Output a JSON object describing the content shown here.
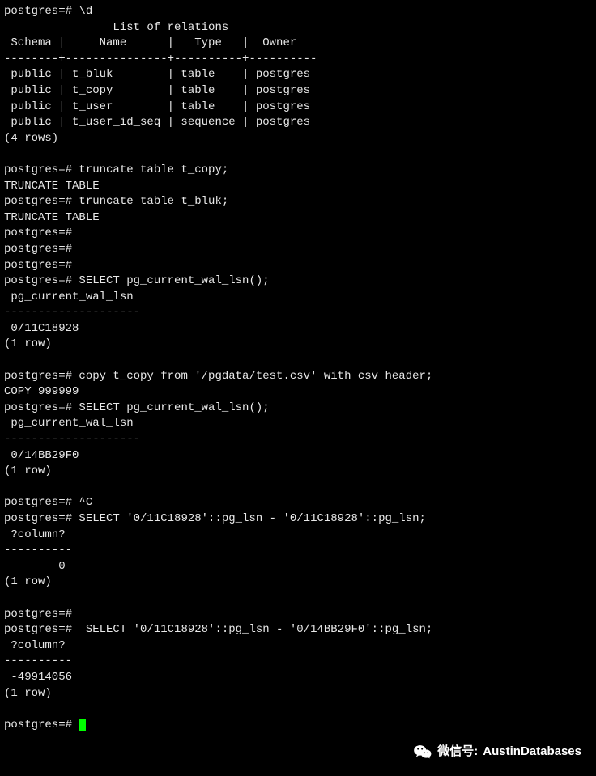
{
  "prompt": "postgres=#",
  "relations_header": "                List of relations",
  "relations_cols": " Schema |     Name      |   Type   |  Owner   ",
  "relations_sep": "--------+---------------+----------+----------",
  "relations_rows": [
    " public | t_bluk        | table    | postgres",
    " public | t_copy        | table    | postgres",
    " public | t_user        | table    | postgres",
    " public | t_user_id_seq | sequence | postgres"
  ],
  "relations_count": "(4 rows)",
  "cmd_d": "\\d",
  "cmd_trunc1": "truncate table t_copy;",
  "resp_trunc": "TRUNCATE TABLE",
  "cmd_trunc2": "truncate table t_bluk;",
  "cmd_wal": "SELECT pg_current_wal_lsn();",
  "wal_col": " pg_current_wal_lsn ",
  "wal_sep": "--------------------",
  "wal_val1": " 0/11C18928",
  "wal_val2": " 0/14BB29F0",
  "row1": "(1 row)",
  "cmd_copy": "copy t_copy from '/pgdata/test.csv' with csv header;",
  "resp_copy": "COPY 999999",
  "cmd_ctrlc": "^C",
  "cmd_lsn1": "SELECT '0/11C18928'::pg_lsn - '0/11C18928'::pg_lsn;",
  "qcol": " ?column? ",
  "qsep": "----------",
  "qval1": "        0",
  "cmd_lsn2": " SELECT '0/11C18928'::pg_lsn - '0/14BB29F0'::pg_lsn;",
  "qval2": " -49914056",
  "watermark_label": "微信号:",
  "watermark_name": "AustinDatabases"
}
